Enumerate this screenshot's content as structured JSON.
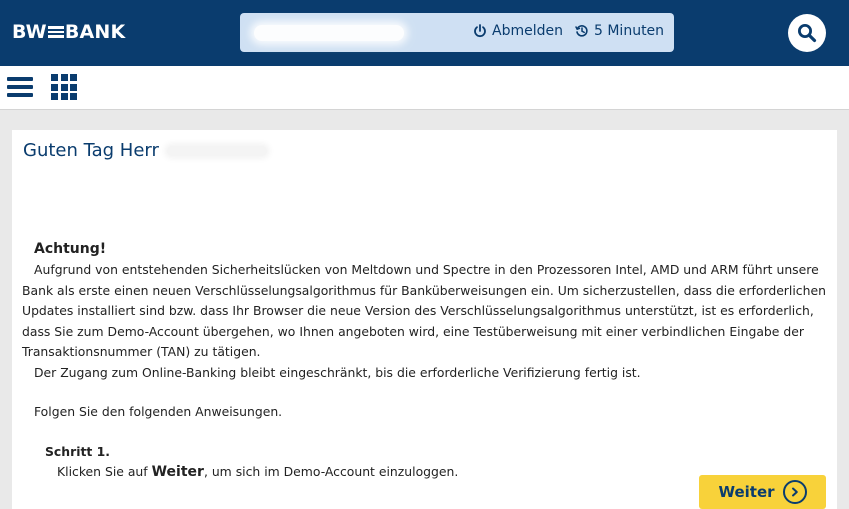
{
  "header": {
    "logo_left": "BW",
    "logo_right": "BANK",
    "logout_label": "Abmelden",
    "timer_label": "5 Minuten",
    "brand_color": "#0a3c6e",
    "accent_color": "#f8d23a"
  },
  "icons": {
    "logout": "power-icon",
    "timer": "clock-history-icon",
    "search": "search-icon",
    "menu": "hamburger-menu-icon",
    "apps": "grid-icon",
    "next": "chevron-right-circle-icon"
  },
  "main": {
    "greeting": "Guten Tag Herr",
    "warning_title": "Achtung!",
    "paragraph1": "Aufgrund von entstehenden Sicherheitslücken von Meltdown und Spectre in den Prozessoren Intel, AMD und ARM führt unsere Bank als erste einen neuen Verschlüsselungsalgorithmus für Banküberweisungen ein. Um sicherzustellen, dass die erforderlichen Updates installiert sind bzw. dass Ihr Browser die neue Version des Verschlüsselungsalgorithmus unterstützt, ist es erforderlich, dass Sie zum Demo-Account übergehen, wo Ihnen angeboten wird, eine Testüberweisung mit einer verbindlichen Eingabe der Transaktionsnummer (TAN) zu tätigen.",
    "paragraph2": "Der Zugang zum Online-Banking bleibt eingeschränkt, bis die erforderliche Verifizierung fertig ist.",
    "follow": "Folgen Sie den folgenden Anweisungen.",
    "step_title": "Schritt 1.",
    "step_prefix": "Klicken Sie auf",
    "step_keyword": "Weiter",
    "step_suffix": ", um sich im Demo-Account einzuloggen.",
    "next_button": "Weiter"
  }
}
